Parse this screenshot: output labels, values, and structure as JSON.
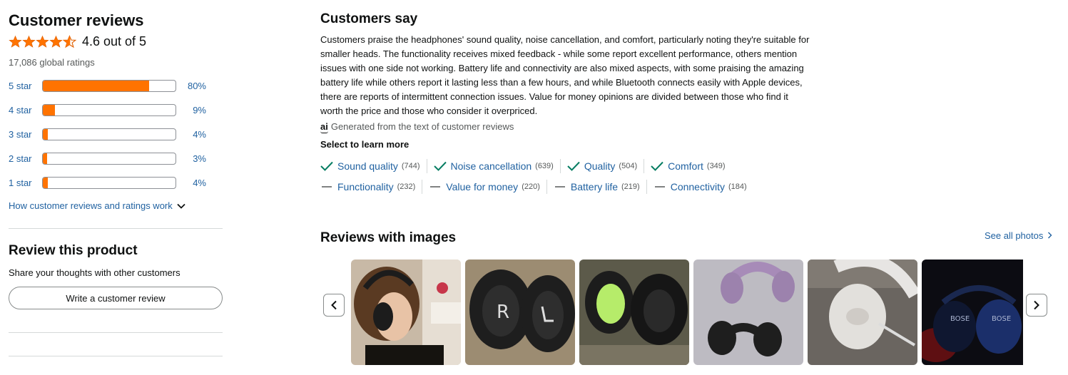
{
  "reviews": {
    "title": "Customer reviews",
    "average": "4.6 out of 5",
    "global_ratings": "17,086 global ratings",
    "star_color": "#ff7300",
    "histogram": [
      {
        "label": "5 star",
        "percent_text": "80%",
        "value": 0.8
      },
      {
        "label": "4 star",
        "percent_text": "9%",
        "value": 0.09
      },
      {
        "label": "3 star",
        "percent_text": "4%",
        "value": 0.04
      },
      {
        "label": "2 star",
        "percent_text": "3%",
        "value": 0.03
      },
      {
        "label": "1 star",
        "percent_text": "4%",
        "value": 0.04
      }
    ],
    "how_link": "How customer reviews and ratings work"
  },
  "review_product": {
    "title": "Review this product",
    "subtitle": "Share your thoughts with other customers",
    "button": "Write a customer review"
  },
  "customers_say": {
    "title": "Customers say",
    "summary": "Customers praise the headphones' sound quality, noise cancellation, and comfort, particularly noting they're suitable for smaller heads. The functionality receives mixed feedback - while some report excellent performance, others mention issues with one side not working. Battery life and connectivity are also mixed aspects, with some praising the amazing battery life while others report it lasting less than a few hours, and while Bluetooth connects easily with Apple devices, there are reports of intermittent connection issues. Value for money opinions are divided between those who find it worth the price and those who consider it overpriced.",
    "ai_icon": "ai",
    "ai_note": "Generated from the text of customer reviews",
    "learn_more": "Select to learn more",
    "aspects_positive": [
      {
        "label": "Sound quality",
        "count": "(744)",
        "icon": "check-icon"
      },
      {
        "label": "Noise cancellation",
        "count": "(639)",
        "icon": "check-icon"
      },
      {
        "label": "Quality",
        "count": "(504)",
        "icon": "check-icon"
      },
      {
        "label": "Comfort",
        "count": "(349)",
        "icon": "check-icon"
      }
    ],
    "aspects_mixed": [
      {
        "label": "Functionality",
        "count": "(232)",
        "icon": "dash-icon"
      },
      {
        "label": "Value for money",
        "count": "(220)",
        "icon": "dash-icon"
      },
      {
        "label": "Battery life",
        "count": "(219)",
        "icon": "dash-icon"
      },
      {
        "label": "Connectivity",
        "count": "(184)",
        "icon": "dash-icon"
      }
    ]
  },
  "images": {
    "title": "Reviews with images",
    "see_all": "See all photos",
    "thumbnails": [
      {
        "name": "review-photo-person-wearing-headphones"
      },
      {
        "name": "review-photo-ear-cushions"
      },
      {
        "name": "review-photo-worn-ear-pad"
      },
      {
        "name": "review-photo-purple-and-black-headphones"
      },
      {
        "name": "review-photo-white-headphones"
      },
      {
        "name": "review-photo-headphones-dark-lighting"
      }
    ]
  }
}
